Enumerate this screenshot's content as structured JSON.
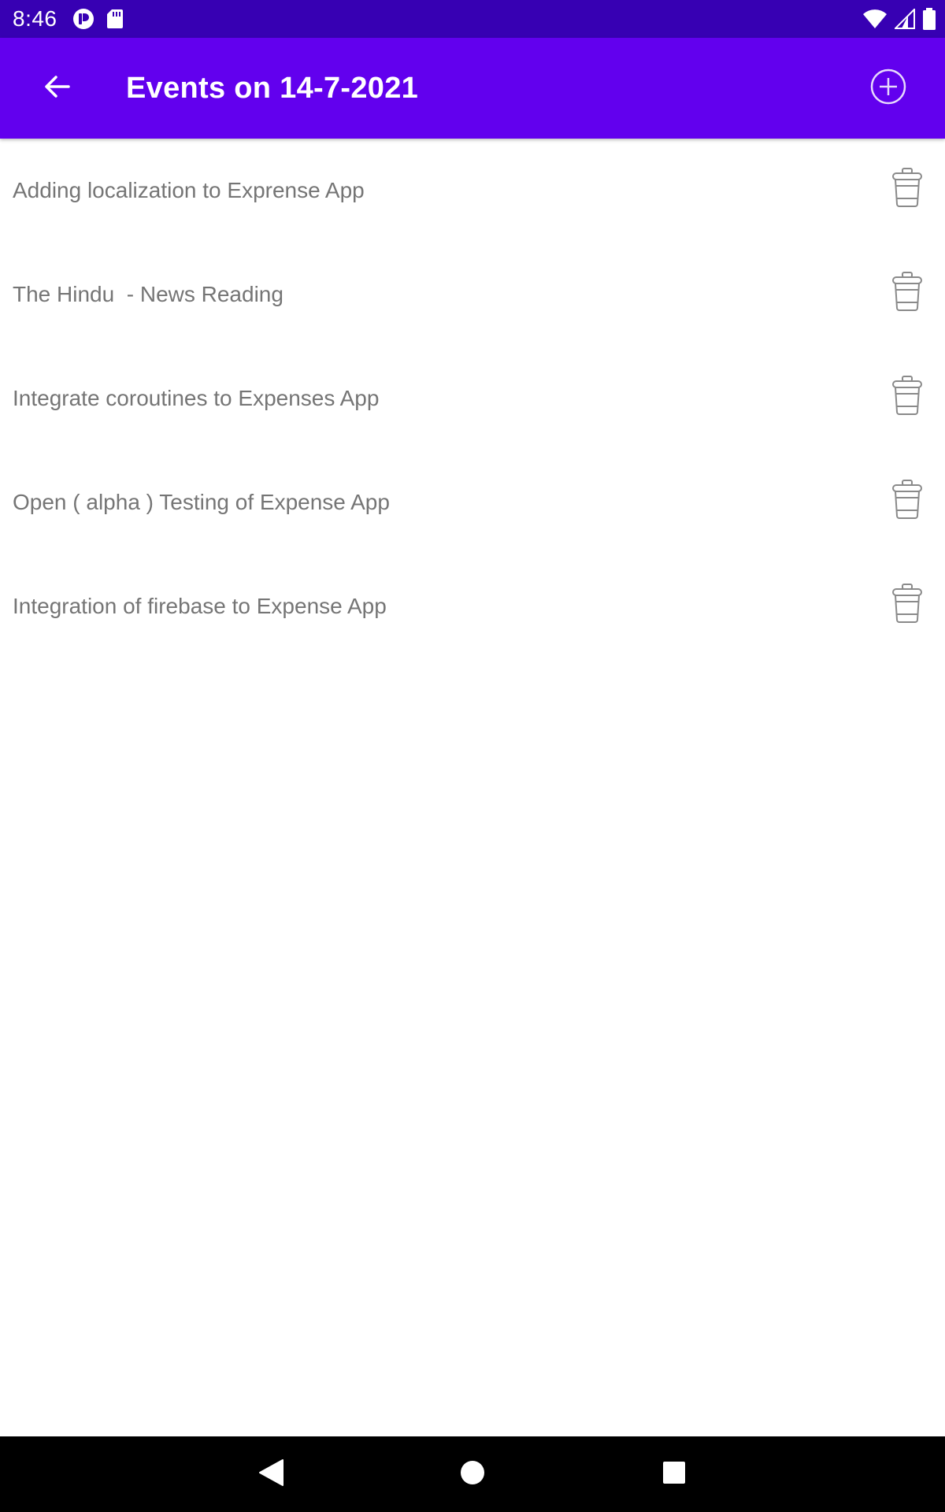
{
  "status_bar": {
    "time": "8:46",
    "left_icons": [
      "notification-app-icon",
      "sd-card-icon"
    ],
    "right_icons": [
      "wifi-icon",
      "cell-signal-icon",
      "battery-icon"
    ]
  },
  "app_bar": {
    "title": "Events on 14-7-2021",
    "back_icon": "arrow-back-icon",
    "add_icon": "add-circle-icon"
  },
  "events": [
    {
      "title": "Adding localization to Exprense App",
      "action_icon": "delete-icon"
    },
    {
      "title": "The Hindu  - News Reading",
      "action_icon": "delete-icon"
    },
    {
      "title": "Integrate coroutines to Expenses App",
      "action_icon": "delete-icon"
    },
    {
      "title": "Open ( alpha ) Testing of Expense App",
      "action_icon": "delete-icon"
    },
    {
      "title": "Integration of firebase to Expense App",
      "action_icon": "delete-icon"
    }
  ],
  "nav_bar": {
    "buttons": [
      "nav-back-icon",
      "nav-home-icon",
      "nav-recents-icon"
    ]
  },
  "colors": {
    "status_bar": "#3700b3",
    "app_bar": "#6200ee",
    "list_text": "#757575",
    "icon_gray": "#8a8a8a",
    "nav_bar": "#000000"
  }
}
